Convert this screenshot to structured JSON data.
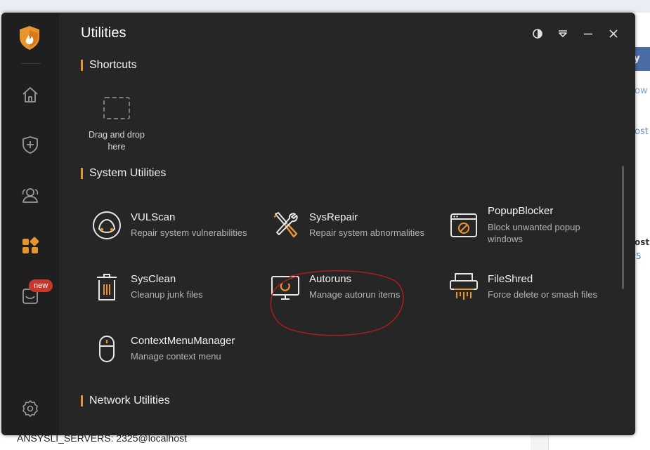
{
  "background": {
    "button_fragment": "y",
    "link_fragment": "ow",
    "text_fragment_1": "ost",
    "text_fragment_2": "ost",
    "text_fragment_3": "5",
    "status_line": "ANSYSLI_SERVERS: 2325@localhost"
  },
  "window": {
    "title": "Utilities",
    "accent_color": "#e8952f"
  },
  "sidebar": {
    "items": [
      {
        "name": "home",
        "icon": "home-icon"
      },
      {
        "name": "protection",
        "icon": "shield-plus-icon"
      },
      {
        "name": "users",
        "icon": "users-icon"
      },
      {
        "name": "utilities",
        "icon": "apps-grid-icon",
        "active": true
      },
      {
        "name": "new-feature",
        "icon": "box-icon",
        "badge": "new"
      },
      {
        "name": "settings",
        "icon": "gear-icon"
      }
    ]
  },
  "sections": {
    "shortcuts": "Shortcuts",
    "system": "System Utilities",
    "network": "Network Utilities"
  },
  "dropzone": {
    "text_line1": "Drag and drop",
    "text_line2": "here"
  },
  "tools": [
    {
      "name": "VULScan",
      "desc": "Repair system vulnerabilities",
      "icon": "scan-icon"
    },
    {
      "name": "SysRepair",
      "desc": "Repair system abnormalities",
      "icon": "tools-icon"
    },
    {
      "name": "PopupBlocker",
      "desc": "Block unwanted popup windows",
      "icon": "popup-block-icon"
    },
    {
      "name": "SysClean",
      "desc": "Cleanup junk files",
      "icon": "trash-icon"
    },
    {
      "name": "Autoruns",
      "desc": "Manage autorun items",
      "icon": "monitor-icon"
    },
    {
      "name": "FileShred",
      "desc": "Force delete or smash files",
      "icon": "shredder-icon"
    },
    {
      "name": "ContextMenuManager",
      "desc": "Manage context menu",
      "icon": "mouse-icon"
    }
  ]
}
